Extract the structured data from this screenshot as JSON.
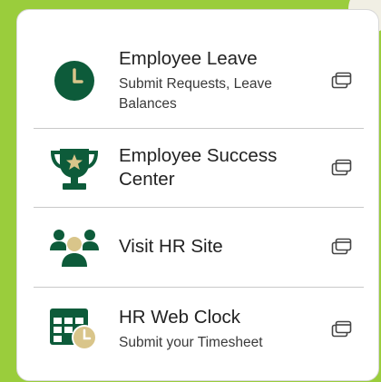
{
  "theme": {
    "accent": "#0d5b3a",
    "accent_light": "#d9c58a",
    "background": "#9acd3c"
  },
  "links": [
    {
      "title": "Employee Leave",
      "subtitle": "Submit Requests, Leave Balances",
      "icon": "clock-icon"
    },
    {
      "title": "Employee Success Center",
      "subtitle": "",
      "icon": "trophy-icon"
    },
    {
      "title": "Visit HR Site",
      "subtitle": "",
      "icon": "people-group-icon"
    },
    {
      "title": "HR Web Clock",
      "subtitle": "Submit your Timesheet",
      "icon": "timesheet-clock-icon"
    }
  ]
}
